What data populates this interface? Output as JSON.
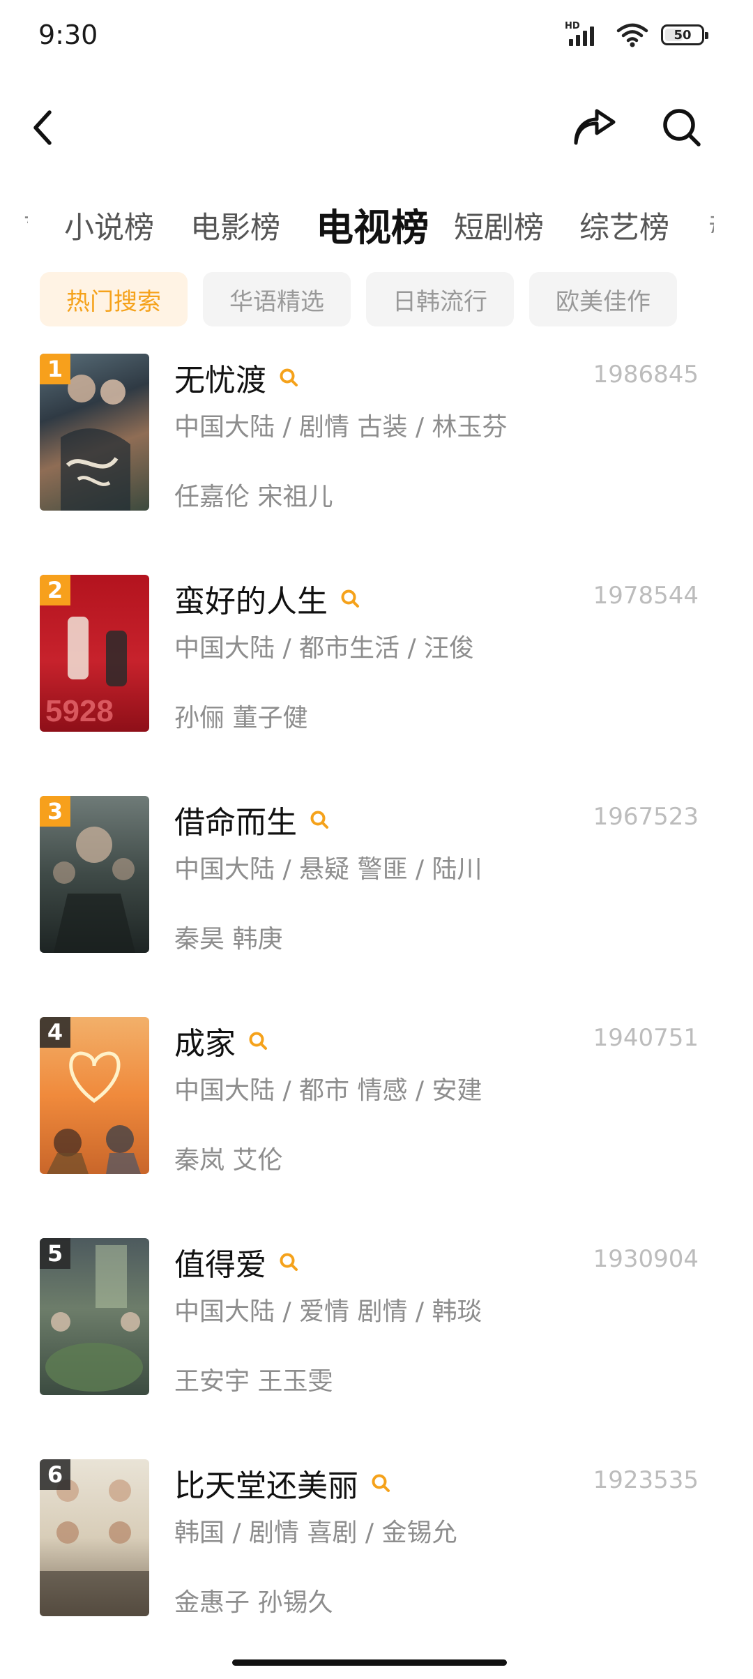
{
  "status_bar": {
    "time": "9:30",
    "network": "HD",
    "battery": "50",
    "battery_level": 0.5
  },
  "tabs": [
    "小说榜",
    "电影榜",
    "电视榜",
    "短剧榜",
    "综艺榜"
  ],
  "active_tab_index": 2,
  "filters": [
    "热门搜索",
    "华语精选",
    "日韩流行",
    "欧美佳作"
  ],
  "active_filter_index": 0,
  "accent_color": "#f7a01c",
  "items": [
    {
      "rank": "1",
      "title": "无忧渡",
      "heat": "1986845",
      "meta": "中国大陆 / 剧情 古装 / 林玉芬",
      "actors": "任嘉伦 宋祖儿"
    },
    {
      "rank": "2",
      "title": "蛮好的人生",
      "heat": "1978544",
      "meta": "中国大陆 / 都市生活 / 汪俊",
      "actors": "孙俪 董子健"
    },
    {
      "rank": "3",
      "title": "借命而生",
      "heat": "1967523",
      "meta": "中国大陆 / 悬疑 警匪 / 陆川",
      "actors": "秦昊 韩庚"
    },
    {
      "rank": "4",
      "title": "成家",
      "heat": "1940751",
      "meta": "中国大陆 / 都市 情感 / 安建",
      "actors": "秦岚 艾伦"
    },
    {
      "rank": "5",
      "title": "值得爱",
      "heat": "1930904",
      "meta": "中国大陆 / 爱情 剧情 / 韩琰",
      "actors": "王安宇 王玉雯"
    },
    {
      "rank": "6",
      "title": "比天堂还美丽",
      "heat": "1923535",
      "meta": "韩国 / 剧情 喜剧 / 金锡允",
      "actors": "金惠子 孙锡久"
    }
  ]
}
